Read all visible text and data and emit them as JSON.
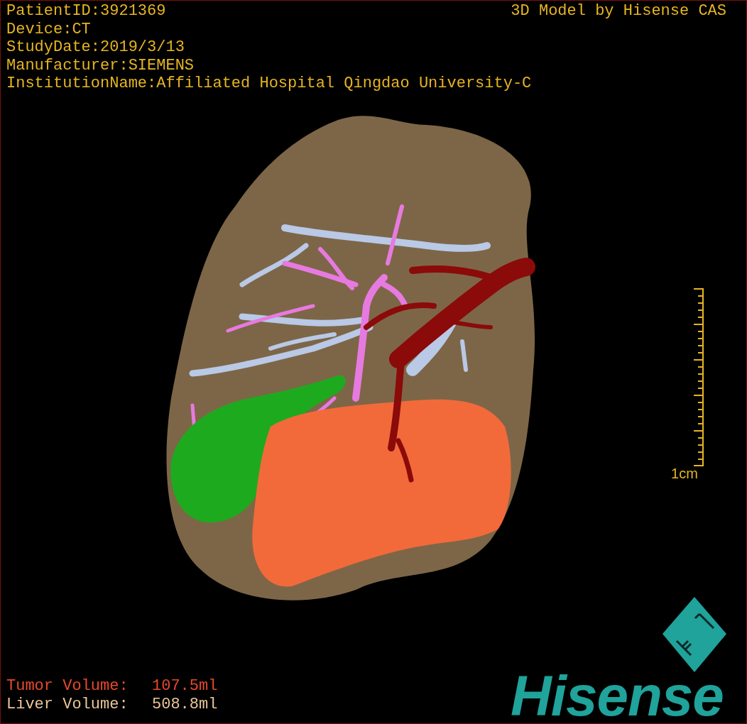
{
  "info_lines": [
    "PatientID:3921369",
    "Device:CT",
    "StudyDate:2019/3/13",
    "Manufacturer:SIEMENS",
    "InstitutionName:Affiliated Hospital Qingdao University-C"
  ],
  "watermark_caption": "3D Model by Hisense CAS",
  "scale_bar": {
    "label": "1cm"
  },
  "volumes": [
    {
      "kind": "tumor",
      "label": "Tumor Volume:",
      "value": "107.5ml"
    },
    {
      "kind": "liver",
      "label": "Liver Volume:",
      "value": "508.8ml"
    }
  ],
  "brand": {
    "name": "Hisense"
  }
}
